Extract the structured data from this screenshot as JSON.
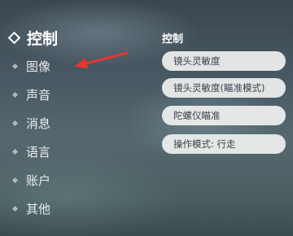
{
  "menu": {
    "items": [
      {
        "label": "控制",
        "active": true
      },
      {
        "label": "图像"
      },
      {
        "label": "声音"
      },
      {
        "label": "消息"
      },
      {
        "label": "语言"
      },
      {
        "label": "账户"
      },
      {
        "label": "其他"
      }
    ]
  },
  "panel": {
    "title": "控制",
    "options": [
      "镜头灵敏度",
      "镜头灵敏度(瞄准模式)",
      "陀螺仪瞄准",
      "操作模式: 行走"
    ]
  },
  "colors": {
    "annotation_arrow": "#e8352f",
    "option_background": "#eef0ee"
  }
}
